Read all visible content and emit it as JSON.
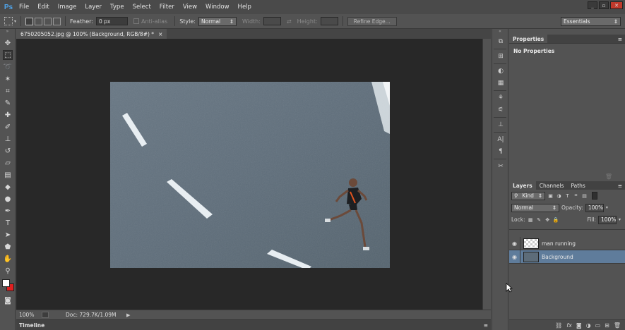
{
  "app": {
    "logo": "Ps"
  },
  "menu": [
    "File",
    "Edit",
    "Image",
    "Layer",
    "Type",
    "Select",
    "Filter",
    "View",
    "Window",
    "Help"
  ],
  "window_controls": {
    "minimize": "_",
    "restore": "▫",
    "close": "✕"
  },
  "options": {
    "feather_label": "Feather:",
    "feather_value": "0 px",
    "anti_alias_label": "Anti-alias",
    "style_label": "Style:",
    "style_value": "Normal",
    "width_label": "Width:",
    "swap": "⇄",
    "height_label": "Height:",
    "refine_edge": "Refine Edge...",
    "workspace": "Essentials"
  },
  "document": {
    "tab_title": "6750205052.jpg @ 100% (Background, RGB/8#) *",
    "close_icon": "×"
  },
  "status": {
    "zoom": "100%",
    "doc_info": "Doc: 729.7K/1.09M"
  },
  "timeline": {
    "label": "Timeline"
  },
  "properties": {
    "title": "Properties",
    "body": "No Properties"
  },
  "layers_panel": {
    "tabs": [
      "Layers",
      "Channels",
      "Paths"
    ],
    "filter_kind": "Kind",
    "blend_mode": "Normal",
    "opacity_label": "Opacity:",
    "opacity_value": "100%",
    "lock_label": "Lock:",
    "fill_label": "Fill:",
    "fill_value": "100%",
    "layers": [
      {
        "name": "man running",
        "visible": true,
        "selected": false
      },
      {
        "name": "Background",
        "visible": true,
        "selected": true
      }
    ]
  },
  "colors": {
    "accent_selected_layer": "#5f7c9b",
    "ps_logo": "#4fa3e8",
    "foreground": "#ffffff",
    "background_swatch": "#e02020"
  }
}
